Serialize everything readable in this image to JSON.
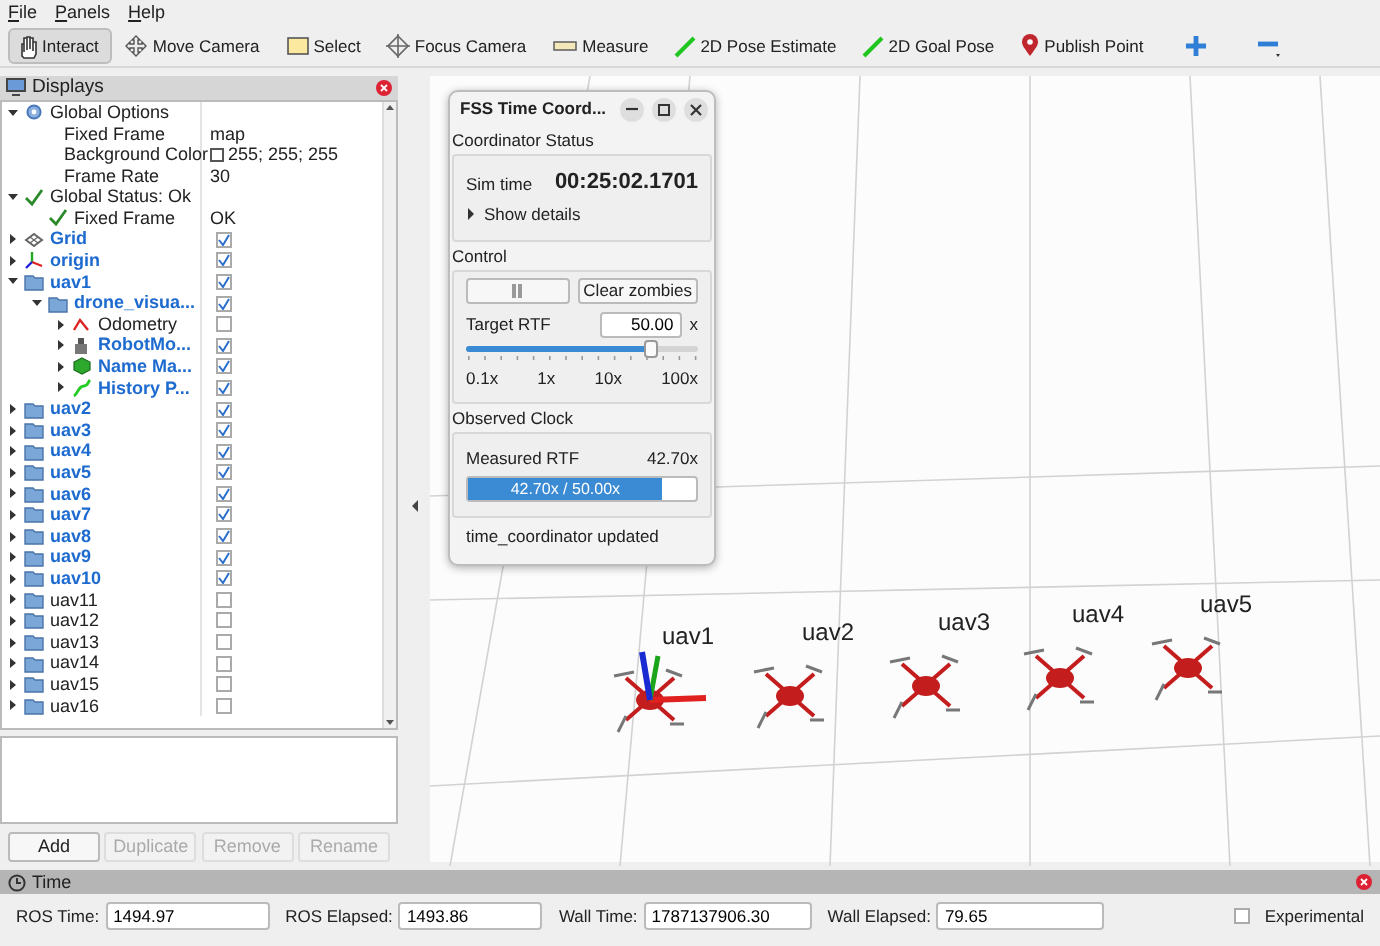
{
  "menu_bar": [
    {
      "label": "File"
    },
    {
      "label": "Panels"
    },
    {
      "label": "Help"
    }
  ],
  "toolbar": [
    {
      "kind": "interact",
      "label": "Interact",
      "selected": true
    },
    {
      "kind": "move",
      "label": "Move Camera",
      "selected": false
    },
    {
      "kind": "select",
      "label": "Select",
      "selected": false
    },
    {
      "kind": "focus",
      "label": "Focus Camera",
      "selected": false
    },
    {
      "kind": "measure",
      "label": "Measure",
      "selected": false
    },
    {
      "kind": "pose",
      "label": "2D Pose Estimate",
      "selected": false
    },
    {
      "kind": "pose",
      "label": "2D Goal Pose",
      "selected": false
    },
    {
      "kind": "pin",
      "label": "Publish Point",
      "selected": false
    },
    {
      "kind": "plus",
      "selected": false
    },
    {
      "kind": "minus",
      "selected": false
    }
  ],
  "displays_panel": {
    "title": "Displays",
    "tree": [
      {
        "kind": "options",
        "label": "Global Options",
        "expanded": true,
        "children": [
          {
            "kind": "property",
            "label": "Fixed Frame",
            "value": "map"
          },
          {
            "kind": "color_property",
            "label": "Background Color",
            "value": "255; 255; 255"
          },
          {
            "kind": "property",
            "label": "Frame Rate",
            "value": "30"
          }
        ]
      },
      {
        "kind": "status",
        "label": "Global Status: Ok",
        "expanded": true,
        "children": [
          {
            "kind": "status",
            "label": "Fixed Frame",
            "value": "OK"
          }
        ]
      },
      {
        "kind": "grid",
        "label": "Grid",
        "expanded": false,
        "checked": true
      },
      {
        "kind": "axes",
        "label": "origin",
        "expanded": false,
        "checked": true
      },
      {
        "kind": "group",
        "label": "uav1",
        "expanded": true,
        "checked": true,
        "children": [
          {
            "kind": "group",
            "label": "drone_visua...",
            "expanded": true,
            "checked": true,
            "children": [
              {
                "kind": "odometry",
                "label": "Odometry",
                "expanded": false,
                "checked": false
              },
              {
                "kind": "robot",
                "label": "RobotMo...",
                "expanded": false,
                "checked": true
              },
              {
                "kind": "marker",
                "label": "Name Ma...",
                "expanded": false,
                "checked": true
              },
              {
                "kind": "path",
                "label": "History P...",
                "expanded": false,
                "checked": true
              }
            ]
          }
        ]
      },
      {
        "kind": "group",
        "label": "uav2",
        "expanded": false,
        "checked": true
      },
      {
        "kind": "group",
        "label": "uav3",
        "expanded": false,
        "checked": true
      },
      {
        "kind": "group",
        "label": "uav4",
        "expanded": false,
        "checked": true
      },
      {
        "kind": "group",
        "label": "uav5",
        "expanded": false,
        "checked": true
      },
      {
        "kind": "group",
        "label": "uav6",
        "expanded": false,
        "checked": true
      },
      {
        "kind": "group",
        "label": "uav7",
        "expanded": false,
        "checked": true
      },
      {
        "kind": "group",
        "label": "uav8",
        "expanded": false,
        "checked": true
      },
      {
        "kind": "group",
        "label": "uav9",
        "expanded": false,
        "checked": true
      },
      {
        "kind": "group",
        "label": "uav10",
        "expanded": false,
        "checked": true
      },
      {
        "kind": "group",
        "label": "uav11",
        "expanded": false,
        "checked": false
      },
      {
        "kind": "group",
        "label": "uav12",
        "expanded": false,
        "checked": false
      },
      {
        "kind": "group",
        "label": "uav13",
        "expanded": false,
        "checked": false
      },
      {
        "kind": "group",
        "label": "uav14",
        "expanded": false,
        "checked": false
      },
      {
        "kind": "group",
        "label": "uav15",
        "expanded": false,
        "checked": false
      },
      {
        "kind": "group",
        "label": "uav16",
        "expanded": false,
        "checked": false
      }
    ],
    "buttons": [
      {
        "label": "Add",
        "disabled": false
      },
      {
        "label": "Duplicate",
        "disabled": true
      },
      {
        "label": "Remove",
        "disabled": true
      },
      {
        "label": "Rename",
        "disabled": true
      }
    ]
  },
  "viewport": {
    "drones": [
      {
        "label": "uav1",
        "axes": true
      },
      {
        "label": "uav2",
        "axes": false
      },
      {
        "label": "uav3",
        "axes": false
      },
      {
        "label": "uav4",
        "axes": false
      },
      {
        "label": "uav5",
        "axes": false
      }
    ]
  },
  "dialog": {
    "title": "FSS Time Coord...",
    "status": {
      "heading": "Coordinator Status",
      "sim_time_label": "Sim time",
      "sim_time": "00:25:02.1701",
      "details": "Show details",
      "expanded": false
    },
    "control": {
      "heading": "Control",
      "clear_button": "Clear zombies",
      "target_label": "Target RTF",
      "target_value": "50.00",
      "target_unit": "x",
      "slider": {
        "level": 0.79
      },
      "scale_labels": [
        "0.1x",
        "1x",
        "10x",
        "100x"
      ]
    },
    "observed": {
      "heading": "Observed Clock",
      "measured_label": "Measured RTF",
      "measured_value": "42.70x",
      "progress": {
        "level": 0.854,
        "text": "42.70x / 50.00x"
      }
    },
    "status_bar": "time_coordinator updated"
  },
  "time_panel": {
    "title": "Time",
    "fields": [
      {
        "label": "ROS Time:",
        "value": "1494.97"
      },
      {
        "label": "ROS Elapsed:",
        "value": "1493.86"
      },
      {
        "label": "Wall Time:",
        "value": "1787137906.30"
      },
      {
        "label": "Wall Elapsed:",
        "value": "79.65"
      }
    ],
    "experimental": {
      "label": "Experimental",
      "checked": false
    }
  }
}
